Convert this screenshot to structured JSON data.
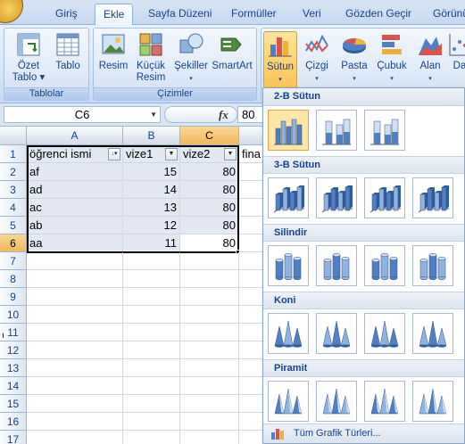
{
  "tabs": [
    {
      "label": "Giriş",
      "active": false
    },
    {
      "label": "Ekle",
      "active": true
    },
    {
      "label": "Sayfa Düzeni",
      "active": false
    },
    {
      "label": "Formüller",
      "active": false
    },
    {
      "label": "Veri",
      "active": false
    },
    {
      "label": "Gözden Geçir",
      "active": false
    },
    {
      "label": "Görünü",
      "active": false
    }
  ],
  "ribbon": {
    "groups": {
      "tables": "Tablolar",
      "illustrations": "Çizimler"
    },
    "buttons": {
      "pivot": [
        "Özet",
        "Tablo ▾"
      ],
      "table": "Tablo",
      "picture": "Resim",
      "clipart": [
        "Küçük",
        "Resim"
      ],
      "shapes": [
        "Şekiller",
        "▾"
      ],
      "smartart": "SmartArt",
      "column": [
        "Sütun",
        "▾"
      ],
      "line": [
        "Çizgi",
        "▾"
      ],
      "pie": [
        "Pasta",
        "▾"
      ],
      "bar": [
        "Çubuk",
        "▾"
      ],
      "area": [
        "Alan",
        "▾"
      ],
      "scatter": "Da"
    }
  },
  "formula_bar": {
    "name_box": "C6",
    "fx": "fx",
    "value": "80"
  },
  "sheet": {
    "columns": [
      "A",
      "B",
      "C"
    ],
    "rows": [
      "1",
      "2",
      "3",
      "4",
      "5",
      "6",
      "7",
      "8",
      "9",
      "10",
      "11",
      "12",
      "13",
      "14",
      "15",
      "16",
      "17"
    ],
    "header": [
      "öğrenci ismi",
      "vize1",
      "vize2",
      "fina"
    ],
    "data": [
      [
        "af",
        "15",
        "80"
      ],
      [
        "ad",
        "14",
        "80"
      ],
      [
        "ac",
        "13",
        "80"
      ],
      [
        "ab",
        "12",
        "80"
      ],
      [
        "aa",
        "11",
        "80"
      ]
    ],
    "side_mark": "ı"
  },
  "dropdown": {
    "sections": [
      "2-B Sütun",
      "3-B Sütun",
      "Silindir",
      "Koni",
      "Piramit"
    ],
    "all_types": "Tüm Grafik Türleri..."
  },
  "colors": {
    "accent": "#f1b85c",
    "ribbon": "#dbe6f3",
    "text": "#15428b"
  }
}
